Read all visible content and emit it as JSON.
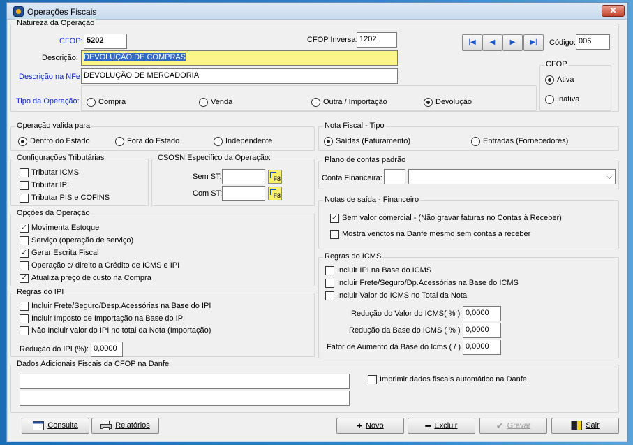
{
  "window": {
    "title": "Operações Fiscais",
    "close_label": "✕"
  },
  "natureza": {
    "group_label": "Natureza da Operação",
    "cfop_label": "CFOP:",
    "cfop_value": "5202",
    "cfop_inversa_label": "CFOP Inversa:",
    "cfop_inversa_value": "1202",
    "descricao_label": "Descrição:",
    "descricao_value": "DEVOLUÇÃO DE COMPRAS",
    "descricao_nfe_label": "Descrição na NFe:",
    "descricao_nfe_value": "DEVOLUÇÃO DE MERCADORIA",
    "tipo_label": "Tipo da Operação:",
    "tipo_options": [
      "Compra",
      "Venda",
      "Outra / Importação",
      "Devolução"
    ],
    "tipo_selected": "Devolução",
    "codigo_label": "Código:",
    "codigo_value": "006",
    "nav_icons": [
      "first-record-icon",
      "prev-record-icon",
      "next-record-icon",
      "last-record-icon"
    ]
  },
  "cfop_status": {
    "group_label": "CFOP",
    "options": [
      "Ativa",
      "Inativa"
    ],
    "selected": "Ativa"
  },
  "operacao_valida": {
    "group_label": "Operação valida para",
    "options": [
      "Dentro do Estado",
      "Fora do Estado",
      "Independente"
    ],
    "selected": "Dentro do Estado"
  },
  "nota_fiscal_tipo": {
    "group_label": "Nota Fiscal - Tipo",
    "options": [
      "Saídas (Faturamento)",
      "Entradas (Fornecedores)"
    ],
    "selected": "Saídas (Faturamento)"
  },
  "config_trib": {
    "group_label": "Configurações Tributárias",
    "items": [
      {
        "label": "Tributar ICMS",
        "checked": false
      },
      {
        "label": "Tributar IPI",
        "checked": false
      },
      {
        "label": "Tributar PIS e COFINS",
        "checked": false
      }
    ]
  },
  "csosn": {
    "group_label": "CSOSN Especifico da Operação:",
    "sem_st_label": "Sem ST:",
    "com_st_label": "Com ST:",
    "f8_label": "F8"
  },
  "plano_contas": {
    "group_label": "Plano de contas padrão",
    "conta_label": "Conta Financeira:"
  },
  "opcoes": {
    "group_label": "Opções da Operação",
    "items": [
      {
        "label": "Movimenta Estoque",
        "checked": true
      },
      {
        "label": "Serviço (operação de serviço)",
        "checked": false
      },
      {
        "label": "Gerar Escrita Fiscal",
        "checked": true
      },
      {
        "label": "Operação c/ direito a Crédito de ICMS e IPI",
        "checked": false
      },
      {
        "label": "Atualiza preço de custo na Compra",
        "checked": true
      }
    ]
  },
  "notas_saida": {
    "group_label": "Notas de saída - Financeiro",
    "items": [
      {
        "label": "Sem valor comercial  - (Não gravar faturas no Contas à Receber)",
        "checked": true
      },
      {
        "label": "Mostra venctos na Danfe mesmo sem contas á receber",
        "checked": false
      }
    ]
  },
  "regras_icms": {
    "group_label": "Regras do ICMS",
    "items": [
      {
        "label": "Incluir IPI na Base do ICMS",
        "checked": false
      },
      {
        "label": "Incluir Frete/Seguro/Dp.Acessórias na Base do ICMS",
        "checked": false
      },
      {
        "label": "Incluir Valor do ICMS no Total da Nota",
        "checked": false
      }
    ],
    "reducao_valor_label": "Redução do Valor do ICMS( % ) :",
    "reducao_valor": "0,0000",
    "reducao_base_label": "Redução da Base do ICMS ( % ) :",
    "reducao_base": "0,0000",
    "fator_label": "Fator de Aumento da Base do Icms ( / ) :",
    "fator": "0,0000"
  },
  "regras_ipi": {
    "group_label": "Regras do IPI",
    "items": [
      {
        "label": "Incluir Frete/Seguro/Desp.Acessórias na Base do IPI",
        "checked": false
      },
      {
        "label": "Incluir Imposto de Importação na Base do IPI",
        "checked": false
      },
      {
        "label": "Não Incluir valor do IPI no total da Nota (Importação)",
        "checked": false
      }
    ],
    "reducao_label": "Redução do IPI (%):",
    "reducao_value": "0,0000"
  },
  "dados_adicionais": {
    "group_label": "Dados Adicionais Fiscais da CFOP na Danfe",
    "imprimir_label": "Imprimir dados fiscais automático na Danfe",
    "imprimir_checked": false
  },
  "footer": {
    "consulta": "Consulta",
    "relatorios": "Relatórios",
    "novo": "Novo",
    "excluir": "Excluir",
    "gravar": "Gravar",
    "sair": "Sair"
  }
}
